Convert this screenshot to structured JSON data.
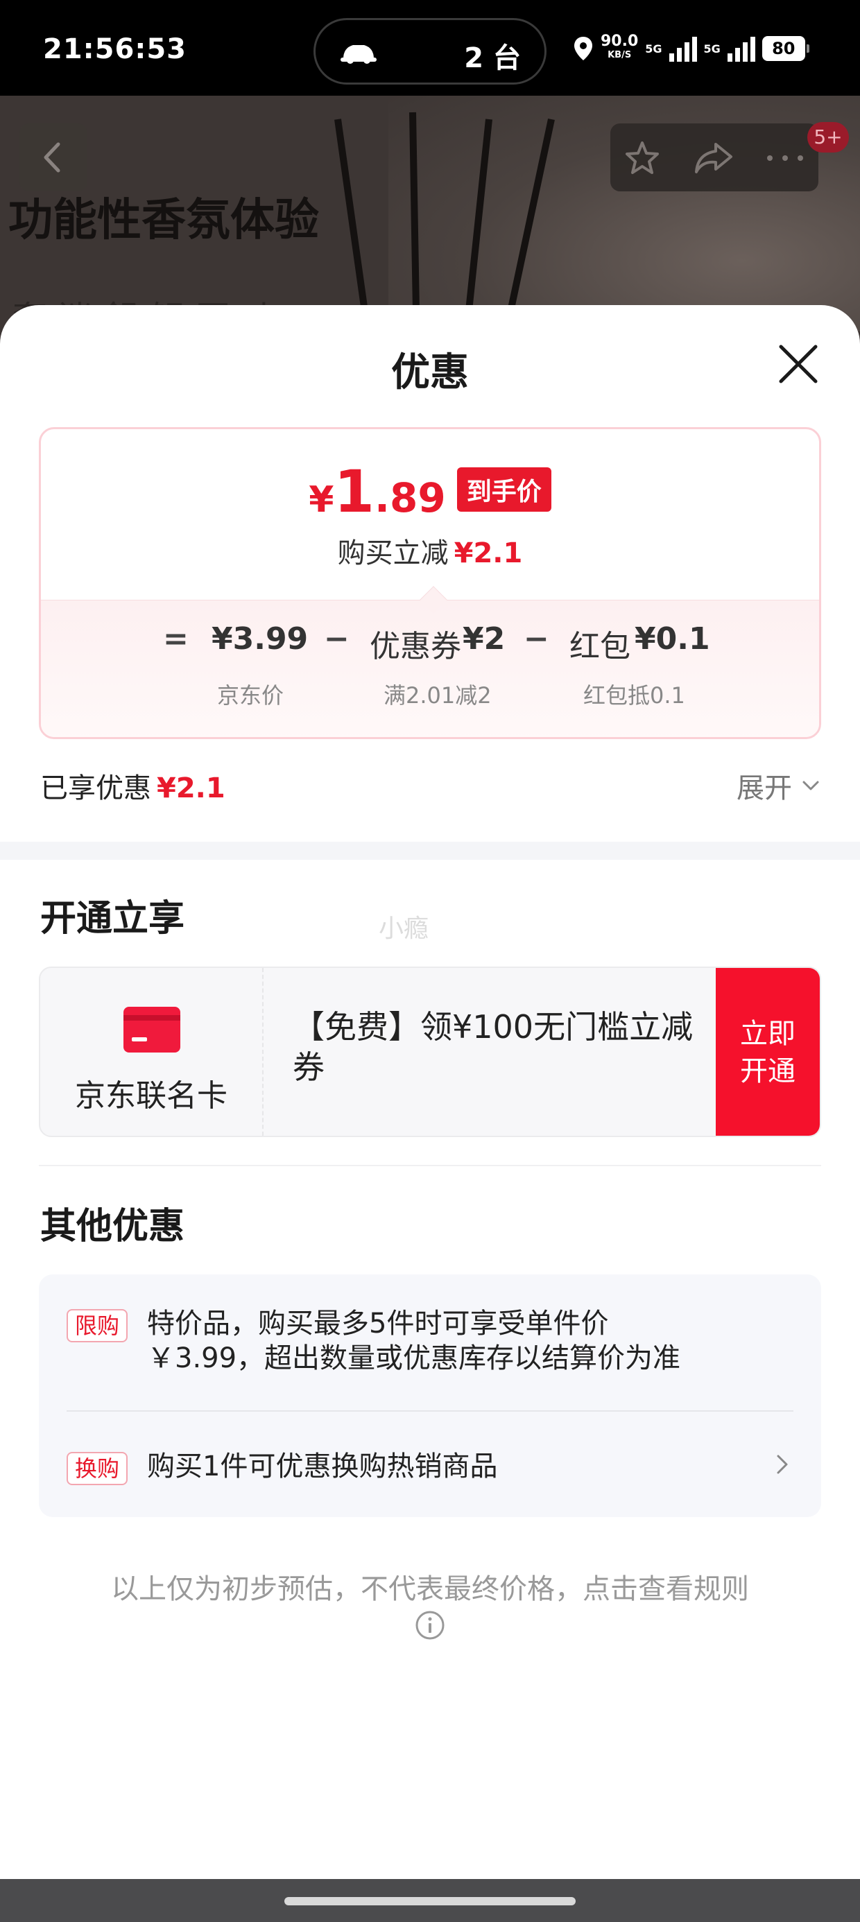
{
  "status_bar": {
    "time": "21:56:53",
    "island_count": "2 台",
    "net_speed": "90.0",
    "net_speed_unit": "KB/S",
    "network_1": "5G",
    "network_2": "5G",
    "battery": "80"
  },
  "background_page": {
    "title": "功能性香氛体验",
    "subtitle": "奢 迷 舒 解 匠 叶",
    "badge": "5+"
  },
  "sheet": {
    "title": "优惠",
    "price_card": {
      "currency": "¥",
      "price_int": "1",
      "price_dec": ".89",
      "price_tag": "到手价",
      "instant_label": "购买立减",
      "instant_value": "¥2.1",
      "equals": "=",
      "minus": "−",
      "jd_price": "¥3.99",
      "jd_price_label": "京东价",
      "coupon_label": "优惠券",
      "coupon_value": "¥2",
      "coupon_desc": "满2.01减2",
      "redpacket_label": "红包",
      "redpacket_value": "¥0.1",
      "redpacket_desc": "红包抵0.1"
    },
    "enjoyed_label": "已享优惠",
    "enjoyed_value": "¥2.1",
    "expand_label": "展开",
    "open_section_title": "开通立享",
    "watermark": "小瘾",
    "card_promo": {
      "card_name": "京东联名卡",
      "description": "【免费】领¥100无门槛立减券",
      "button_line1": "立即",
      "button_line2": "开通"
    },
    "other_section_title": "其他优惠",
    "offers": [
      {
        "tag": "限购",
        "line1": "特价品，购买最多5件时可享受单件价",
        "line2": "￥3.99，超出数量或优惠库存以结算价为准"
      },
      {
        "tag": "换购",
        "line1": "购买1件可优惠换购热销商品"
      }
    ],
    "rules_text": "以上仅为初步预估，不代表最终价格，点击查看规则"
  },
  "colors": {
    "accent_red": "#e8192c",
    "button_red": "#f5112c",
    "card_border": "#fbd0d6"
  },
  "icons": [
    "back-icon",
    "star-icon",
    "share-icon",
    "more-icon",
    "close-icon",
    "chevron-down-icon",
    "credit-card-icon",
    "chevron-right-icon",
    "info-icon"
  ]
}
